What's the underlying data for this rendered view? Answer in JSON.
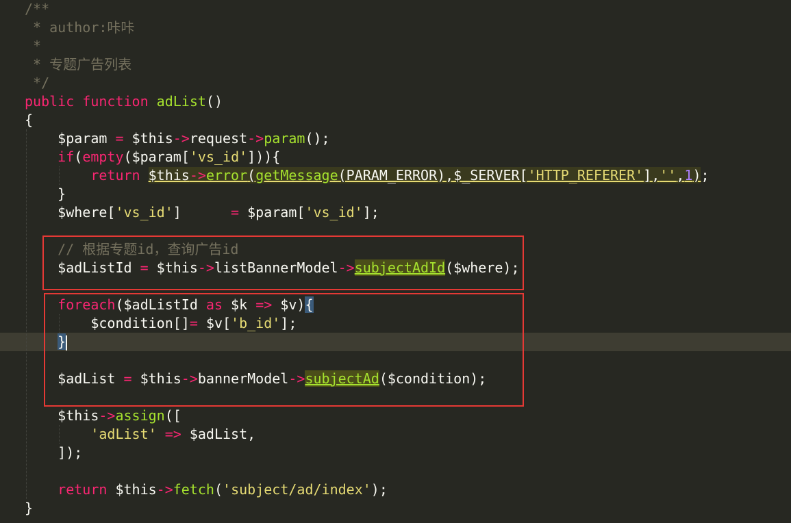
{
  "lines": [
    {
      "tokens": [
        {
          "t": "/**",
          "c": "c-comment"
        }
      ]
    },
    {
      "tokens": [
        {
          "t": " * author:咔咔",
          "c": "c-comment"
        }
      ]
    },
    {
      "tokens": [
        {
          "t": " *",
          "c": "c-comment"
        }
      ]
    },
    {
      "tokens": [
        {
          "t": " * 专题广告列表",
          "c": "c-comment"
        }
      ]
    },
    {
      "tokens": [
        {
          "t": " */",
          "c": "c-comment"
        }
      ]
    },
    {
      "tokens": [
        {
          "t": "public",
          "c": "c-kw"
        },
        {
          "t": " "
        },
        {
          "t": "function",
          "c": "c-kw"
        },
        {
          "t": " "
        },
        {
          "t": "adList",
          "c": "c-fn"
        },
        {
          "t": "()"
        }
      ]
    },
    {
      "tokens": [
        {
          "t": "{"
        }
      ]
    },
    {
      "tokens": [
        {
          "t": "    $param "
        },
        {
          "t": "=",
          "c": "c-kw"
        },
        {
          "t": " $this"
        },
        {
          "t": "->",
          "c": "c-kw"
        },
        {
          "t": "request"
        },
        {
          "t": "->",
          "c": "c-kw"
        },
        {
          "t": "param",
          "c": "c-fn"
        },
        {
          "t": "();"
        }
      ]
    },
    {
      "tokens": [
        {
          "t": "    "
        },
        {
          "t": "if",
          "c": "c-kw"
        },
        {
          "t": "("
        },
        {
          "t": "empty",
          "c": "c-kw"
        },
        {
          "t": "($param["
        },
        {
          "t": "'vs_id'",
          "c": "c-str"
        },
        {
          "t": "])){"
        }
      ]
    },
    {
      "tokens": [
        {
          "t": "        "
        },
        {
          "t": "return",
          "c": "c-kw"
        },
        {
          "t": " "
        },
        {
          "t": "$this",
          "c": "err-ul"
        },
        {
          "t": "->",
          "c": "c-kw err-ul"
        },
        {
          "t": "error",
          "c": "c-fn err-ul"
        },
        {
          "t": "(",
          "c": "err-ul"
        },
        {
          "t": "getMessage",
          "c": "c-fn err-ul"
        },
        {
          "t": "(PARAM_ERROR),$_SERVER[",
          "c": "err-ul"
        },
        {
          "t": "'HTTP_REFERER'",
          "c": "c-str err-ul"
        },
        {
          "t": "],",
          "c": "err-ul"
        },
        {
          "t": "''",
          "c": "c-str err-ul"
        },
        {
          "t": ",",
          "c": "err-ul"
        },
        {
          "t": "1",
          "c": "c-num err-ul"
        },
        {
          "t": ")",
          "c": "err-ul"
        },
        {
          "t": ";"
        }
      ]
    },
    {
      "tokens": [
        {
          "t": "    }"
        }
      ]
    },
    {
      "tokens": [
        {
          "t": "    $where["
        },
        {
          "t": "'vs_id'",
          "c": "c-str"
        },
        {
          "t": "]      "
        },
        {
          "t": "=",
          "c": "c-kw"
        },
        {
          "t": " $param["
        },
        {
          "t": "'vs_id'",
          "c": "c-str"
        },
        {
          "t": "];"
        }
      ]
    },
    {
      "tokens": []
    },
    {
      "tokens": [
        {
          "t": "    // 根据专题id，查询广告id",
          "c": "c-comment"
        }
      ]
    },
    {
      "tokens": [
        {
          "t": "    $adListId "
        },
        {
          "t": "=",
          "c": "c-kw"
        },
        {
          "t": " $this"
        },
        {
          "t": "->",
          "c": "c-kw"
        },
        {
          "t": "listBannerModel"
        },
        {
          "t": "->",
          "c": "c-kw"
        },
        {
          "t": "subjectAdId",
          "c": "hl-word"
        },
        {
          "t": "($where);"
        }
      ]
    },
    {
      "tokens": []
    },
    {
      "tokens": [
        {
          "t": "    "
        },
        {
          "t": "foreach",
          "c": "c-kw"
        },
        {
          "t": "($adListId "
        },
        {
          "t": "as",
          "c": "c-kw"
        },
        {
          "t": " $k "
        },
        {
          "t": "=>",
          "c": "c-kw"
        },
        {
          "t": " $v)"
        },
        {
          "t": "{",
          "c": "brace-hl"
        }
      ]
    },
    {
      "tokens": [
        {
          "t": "        $condition[]"
        },
        {
          "t": "=",
          "c": "c-kw"
        },
        {
          "t": " $v["
        },
        {
          "t": "'b_id'",
          "c": "c-str"
        },
        {
          "t": "];"
        }
      ]
    },
    {
      "tokens": [
        {
          "t": "    "
        },
        {
          "t": "}",
          "c": "brace-hl"
        },
        {
          "t": "",
          "cursor": true
        }
      ]
    },
    {
      "tokens": []
    },
    {
      "tokens": [
        {
          "t": "    $adList "
        },
        {
          "t": "=",
          "c": "c-kw"
        },
        {
          "t": " $this"
        },
        {
          "t": "->",
          "c": "c-kw"
        },
        {
          "t": "bannerModel"
        },
        {
          "t": "->",
          "c": "c-kw"
        },
        {
          "t": "subjectAd",
          "c": "hl-word"
        },
        {
          "t": "($condition);"
        }
      ]
    },
    {
      "tokens": []
    },
    {
      "tokens": [
        {
          "t": "    $this"
        },
        {
          "t": "->",
          "c": "c-kw"
        },
        {
          "t": "assign",
          "c": "c-fn"
        },
        {
          "t": "(["
        }
      ]
    },
    {
      "tokens": [
        {
          "t": "        "
        },
        {
          "t": "'adList'",
          "c": "c-str"
        },
        {
          "t": " "
        },
        {
          "t": "=>",
          "c": "c-kw"
        },
        {
          "t": " $adList,"
        }
      ]
    },
    {
      "tokens": [
        {
          "t": "    ]);"
        }
      ]
    },
    {
      "tokens": []
    },
    {
      "tokens": [
        {
          "t": "    "
        },
        {
          "t": "return",
          "c": "c-kw"
        },
        {
          "t": " $this"
        },
        {
          "t": "->",
          "c": "c-kw"
        },
        {
          "t": "fetch",
          "c": "c-fn"
        },
        {
          "t": "("
        },
        {
          "t": "'subject/ad/index'",
          "c": "c-str"
        },
        {
          "t": ");"
        }
      ]
    },
    {
      "tokens": [
        {
          "t": "}"
        }
      ]
    }
  ]
}
